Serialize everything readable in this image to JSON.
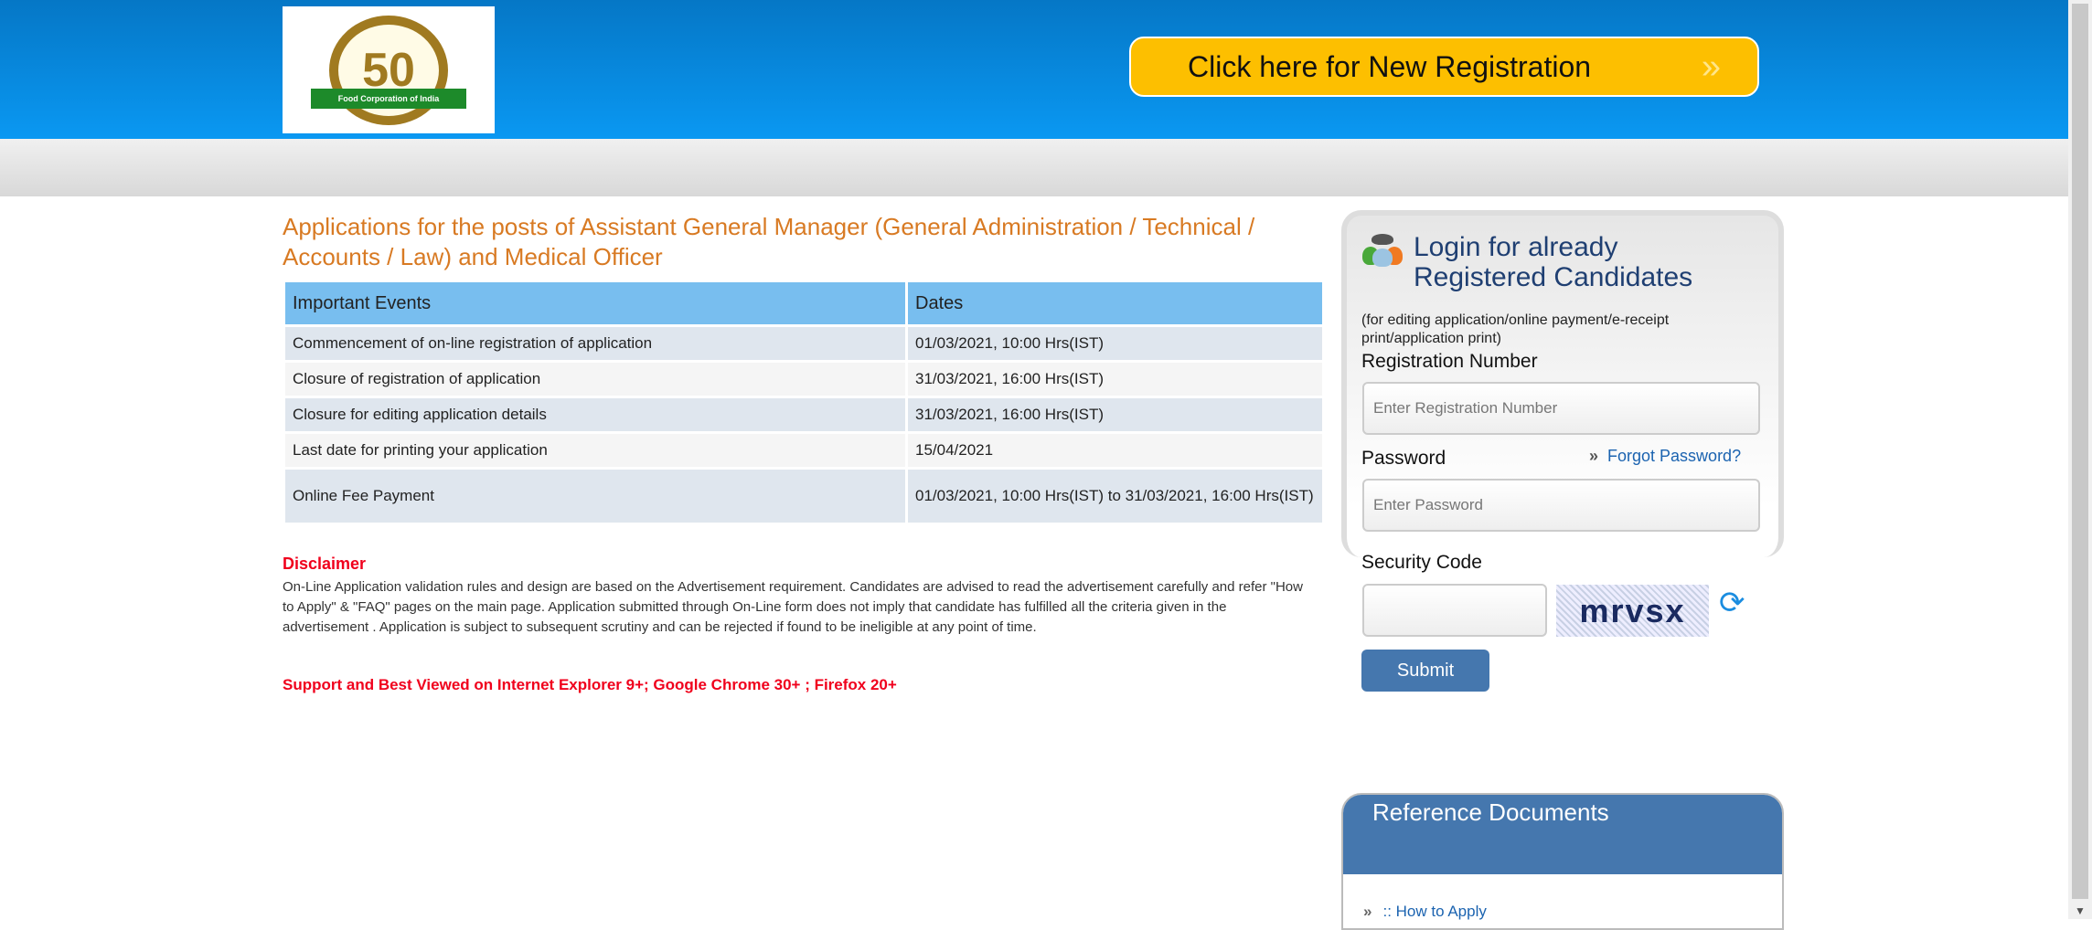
{
  "header": {
    "logo_text": "Food Corporation of India",
    "logo_number": "50",
    "registration_button": "Click here for New Registration",
    "registration_chevron": "»"
  },
  "main": {
    "title": "Applications for the posts of Assistant General Manager (General Administration / Technical / Accounts / Law) and Medical Officer",
    "table": {
      "headers": [
        "Important Events",
        "Dates"
      ],
      "rows": [
        [
          "Commencement of on-line registration of application",
          "01/03/2021, 10:00 Hrs(IST)"
        ],
        [
          "Closure of registration of application",
          "31/03/2021, 16:00 Hrs(IST)"
        ],
        [
          "Closure for editing application details",
          "31/03/2021, 16:00 Hrs(IST)"
        ],
        [
          "Last date for printing your application",
          "15/04/2021"
        ],
        [
          "Online Fee Payment",
          "01/03/2021, 10:00 Hrs(IST) to 31/03/2021, 16:00 Hrs(IST)"
        ]
      ]
    },
    "disclaimer_heading": "Disclaimer",
    "disclaimer_text": "On-Line Application validation rules and design are based on the Advertisement requirement. Candidates are advised to read the advertisement carefully and refer \"How to Apply\" & \"FAQ\" pages on the main page. Application submitted through On-Line form does not imply that candidate has fulfilled all the criteria given in the advertisement . Application is subject to subsequent scrutiny and can be rejected if found to be ineligible at any point of time.",
    "support_text": "Support and Best Viewed on Internet Explorer 9+; Google Chrome 30+ ; Firefox 20+"
  },
  "login": {
    "title_line1": "Login for already",
    "title_line2": "Registered Candidates",
    "subtitle": "(for editing application/online payment/e-receipt print/application print)",
    "registration_label": "Registration Number",
    "registration_placeholder": "Enter Registration Number",
    "password_label": "Password",
    "password_placeholder": "Enter Password",
    "forgot_chevron": "»",
    "forgot_label": "Forgot Password?",
    "security_label": "Security Code",
    "security_value": "",
    "captcha_text": "mrvsx",
    "refresh_glyph": "⟳",
    "submit_label": "Submit"
  },
  "reference": {
    "title": "Reference Documents",
    "items": [
      {
        "chevron": "»",
        "label": ":: How to Apply"
      }
    ]
  },
  "colors": {
    "header_blue": "#0a8ee6",
    "button_yellow": "#fdbf00",
    "title_orange": "#d87a23",
    "panel_blue": "#4577ae",
    "alert_red": "#f0001c"
  }
}
